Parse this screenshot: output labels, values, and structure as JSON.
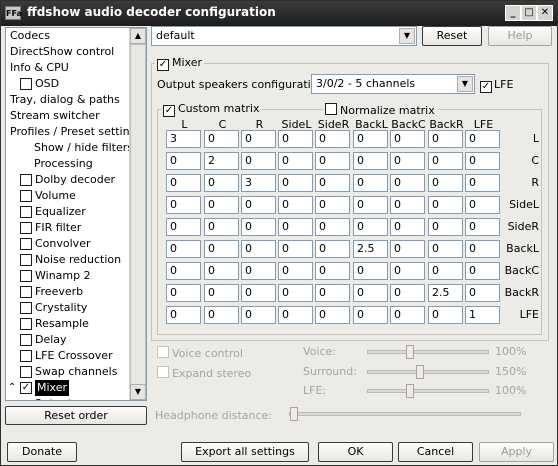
{
  "window": {
    "title": "ffdshow audio decoder configuration",
    "icon": "ffdshow-logo-icon",
    "icon_text": "FFa",
    "minimize": "_",
    "maximize": "□",
    "close": "✕"
  },
  "sidebar": {
    "items": [
      {
        "label": "Codecs",
        "indent": 0,
        "checkbox": false,
        "checked": false
      },
      {
        "label": "DirectShow control",
        "indent": 0,
        "checkbox": false,
        "checked": false
      },
      {
        "label": "Info & CPU",
        "indent": 0,
        "checkbox": false,
        "checked": false
      },
      {
        "label": "OSD",
        "indent": 1,
        "checkbox": true,
        "checked": false
      },
      {
        "label": "Tray, dialog & paths",
        "indent": 0,
        "checkbox": false,
        "checked": false
      },
      {
        "label": "Stream switcher",
        "indent": 0,
        "checkbox": false,
        "checked": false
      },
      {
        "label": "Profiles / Preset settings",
        "indent": 0,
        "checkbox": false,
        "checked": false
      },
      {
        "label": "Show / hide filters",
        "indent": 2,
        "checkbox": false,
        "checked": false
      },
      {
        "label": "Processing",
        "indent": 2,
        "checkbox": false,
        "checked": false
      },
      {
        "label": "Dolby decoder",
        "indent": 1,
        "checkbox": true,
        "checked": false
      },
      {
        "label": "Volume",
        "indent": 1,
        "checkbox": true,
        "checked": false
      },
      {
        "label": "Equalizer",
        "indent": 1,
        "checkbox": true,
        "checked": false
      },
      {
        "label": "FIR filter",
        "indent": 1,
        "checkbox": true,
        "checked": false
      },
      {
        "label": "Convolver",
        "indent": 1,
        "checkbox": true,
        "checked": false
      },
      {
        "label": "Noise reduction",
        "indent": 1,
        "checkbox": true,
        "checked": false
      },
      {
        "label": "Winamp 2",
        "indent": 1,
        "checkbox": true,
        "checked": false
      },
      {
        "label": "Freeverb",
        "indent": 1,
        "checkbox": true,
        "checked": false
      },
      {
        "label": "Crystality",
        "indent": 1,
        "checkbox": true,
        "checked": false
      },
      {
        "label": "Resample",
        "indent": 1,
        "checkbox": true,
        "checked": false
      },
      {
        "label": "Delay",
        "indent": 1,
        "checkbox": true,
        "checked": false
      },
      {
        "label": "LFE Crossover",
        "indent": 1,
        "checkbox": true,
        "checked": false
      },
      {
        "label": "Swap channels",
        "indent": 1,
        "checkbox": true,
        "checked": false
      },
      {
        "label": "Mixer",
        "indent": 1,
        "checkbox": true,
        "checked": true,
        "selected": true
      },
      {
        "label": "Output",
        "indent": 2,
        "checkbox": false,
        "checked": false
      }
    ]
  },
  "reset_order": "Reset order",
  "preset": {
    "value": "default",
    "reset": "Reset",
    "help": "Help"
  },
  "mixer": {
    "label": "Mixer",
    "checked": true,
    "speakers_label": "Output speakers configuration:",
    "speakers_value": "3/0/2 - 5 channels",
    "lfe_label": "LFE",
    "lfe_checked": true,
    "custom_matrix": "Custom matrix",
    "custom_checked": true,
    "normalize_matrix": "Normalize matrix",
    "normalize_checked": false,
    "columns": [
      "L",
      "C",
      "R",
      "SideL",
      "SideR",
      "BackL",
      "BackC",
      "BackR",
      "LFE"
    ],
    "rows": [
      {
        "label": "L",
        "values": [
          "3",
          "0",
          "0",
          "0",
          "0",
          "0",
          "0",
          "0",
          "0"
        ]
      },
      {
        "label": "C",
        "values": [
          "0",
          "2",
          "0",
          "0",
          "0",
          "0",
          "0",
          "0",
          "0"
        ]
      },
      {
        "label": "R",
        "values": [
          "0",
          "0",
          "3",
          "0",
          "0",
          "0",
          "0",
          "0",
          "0"
        ]
      },
      {
        "label": "SideL",
        "values": [
          "0",
          "0",
          "0",
          "0",
          "0",
          "0",
          "0",
          "0",
          "0"
        ]
      },
      {
        "label": "SideR",
        "values": [
          "0",
          "0",
          "0",
          "0",
          "0",
          "0",
          "0",
          "0",
          "0"
        ]
      },
      {
        "label": "BackL",
        "values": [
          "0",
          "0",
          "0",
          "0",
          "0",
          "2.5",
          "0",
          "0",
          "0"
        ]
      },
      {
        "label": "BackC",
        "values": [
          "0",
          "0",
          "0",
          "0",
          "0",
          "0",
          "0",
          "0",
          "0"
        ]
      },
      {
        "label": "BackR",
        "values": [
          "0",
          "0",
          "0",
          "0",
          "0",
          "0",
          "0",
          "2.5",
          "0"
        ]
      },
      {
        "label": "LFE",
        "values": [
          "0",
          "0",
          "0",
          "0",
          "0",
          "0",
          "0",
          "0",
          "1"
        ]
      }
    ]
  },
  "voice_control": "Voice control",
  "expand_stereo": "Expand stereo",
  "sliders": [
    {
      "label": "Voice:",
      "value": "100%",
      "level": 0.33
    },
    {
      "label": "Surround:",
      "value": "150%",
      "level": 0.42
    },
    {
      "label": "LFE:",
      "value": "100%",
      "level": 0.33
    }
  ],
  "headphone": {
    "label": "Headphone distance:",
    "level": 0.0
  },
  "buttons": {
    "donate": "Donate",
    "export": "Export all settings",
    "ok": "OK",
    "cancel": "Cancel",
    "apply": "Apply"
  }
}
